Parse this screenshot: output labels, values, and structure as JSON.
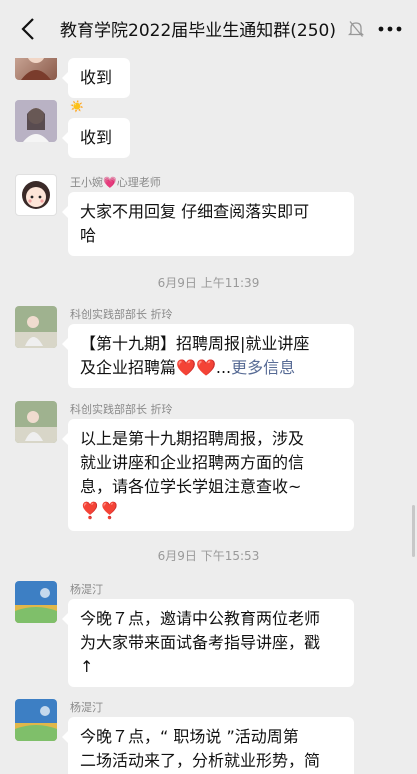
{
  "header": {
    "title": "教育学院2022届毕业生通知群(250)",
    "back_icon": "chevron-left-icon",
    "mute_icon": "bell-off-icon",
    "more_icon": "more-dots-icon"
  },
  "messages": [
    {
      "sender": "",
      "text": "收到"
    },
    {
      "sender": "☀️",
      "text": "收到"
    },
    {
      "sender_name": "王小婉",
      "sender_heart": "💗",
      "sender_role": "心理老师",
      "text_line1": "大家不用回复 仔细查阅落实即可",
      "text_line2": "哈"
    },
    {
      "sender": "科创实践部部长 折玲",
      "text_line1": "【第十九期】招聘周报|就业讲座",
      "text_line2_prefix": "及企业招聘篇",
      "hearts": "❤️❤️",
      "ellipsis": "...",
      "link": "更多信息"
    },
    {
      "sender": "科创实践部部长 折玲",
      "text_line1": "以上是第十九期招聘周报，涉及",
      "text_line2": "就业讲座和企业招聘两方面的信",
      "text_line3": "息，请各位学长学姐注意查收~",
      "hearts": "❣️❣️"
    },
    {
      "sender": "杨湜汀",
      "text_line1": "今晚７点，邀请中公教育两位老师",
      "text_line2": "为大家带来面试备考指导讲座，戳",
      "text_line3": "↑"
    },
    {
      "sender": "杨湜汀",
      "text_line1": "今晚７点，“ 职场说 ”活动周第",
      "text_line2": "二场活动来了，分析就业形势，简"
    }
  ],
  "timestamps": [
    "6月9日 上午11:39",
    "6月9日 下午15:53"
  ],
  "colors": {
    "background": "#ededed",
    "bubble": "#ffffff",
    "link": "#576b95"
  }
}
